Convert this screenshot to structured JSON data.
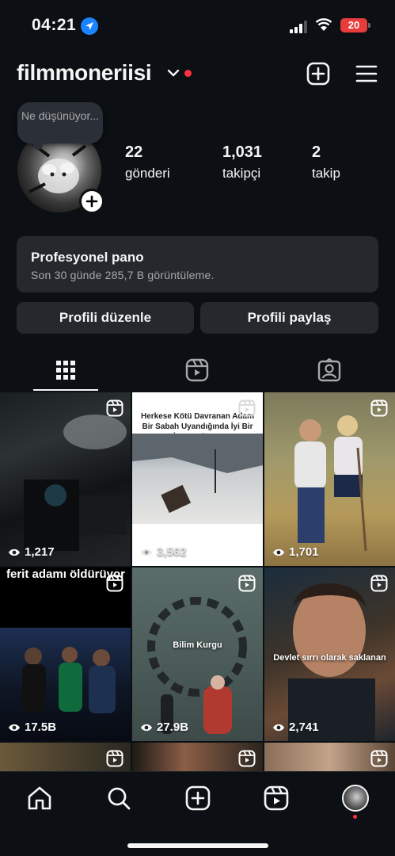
{
  "status_bar": {
    "time": "04:21",
    "battery": "20"
  },
  "header": {
    "username": "filmmoneriisi"
  },
  "profile": {
    "note_text": "Ne düşünüyor...",
    "stats": {
      "posts_count": "22",
      "posts_label": "gönderi",
      "followers_count": "1,031",
      "followers_label": "takipçi",
      "following_count": "2",
      "following_label": "takip"
    }
  },
  "dashboard": {
    "title": "Profesyonel pano",
    "subtitle": "Son 30 günde 285,7 B görüntüleme."
  },
  "buttons": {
    "edit_profile": "Profili düzenle",
    "share_profile": "Profili paylaş"
  },
  "tabs": [
    "grid-icon",
    "reels-icon",
    "tagged-icon"
  ],
  "posts": [
    {
      "views": "1,217"
    },
    {
      "views": "3,562",
      "caption": "Herkese Kötü Davranan Adam Bir Sabah Uyandığında İyi Bir İnsan Oluyor"
    },
    {
      "views": "1,701"
    },
    {
      "views": "17.5B",
      "caption": "ferit adamı öldürüyor"
    },
    {
      "views": "27.9B",
      "caption": "Bilim Kurgu"
    },
    {
      "views": "2,741",
      "caption": "Devlet sırrı olarak saklanan"
    }
  ],
  "colors": {
    "background": "#0c1014",
    "card": "#25292e",
    "notification": "#ff3040",
    "battery_low": "#e83b3b",
    "location": "#1a84ff"
  }
}
